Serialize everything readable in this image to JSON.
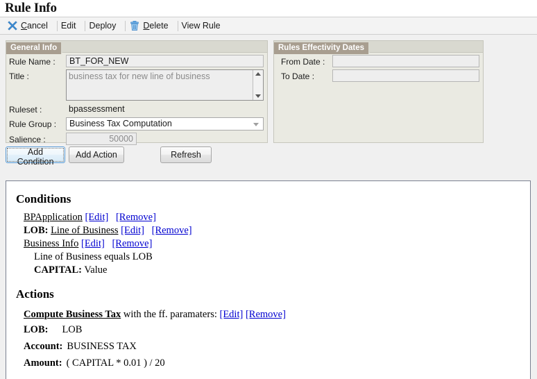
{
  "page": {
    "title": "Rule Info"
  },
  "toolbar": {
    "items": [
      {
        "label": "Cancel",
        "accel": "C",
        "icon": "close-x-icon"
      },
      {
        "label": "Edit",
        "accel": "",
        "icon": ""
      },
      {
        "label": "Deploy",
        "accel": "",
        "icon": ""
      },
      {
        "label": "Delete",
        "accel": "D",
        "icon": "trash-icon"
      },
      {
        "label": "View Rule",
        "accel": "",
        "icon": ""
      }
    ]
  },
  "general_info": {
    "tab_label": "General Info",
    "rule_name_label": "Rule Name :",
    "rule_name_value": "BT_FOR_NEW",
    "title_label": "Title :",
    "title_value": "business tax for new line of business",
    "ruleset_label": "Ruleset :",
    "ruleset_value": "bpassessment",
    "rule_group_label": "Rule Group :",
    "rule_group_value": "Business Tax Computation",
    "salience_label": "Salience :",
    "salience_value": "50000"
  },
  "effectivity_dates": {
    "tab_label": "Rules Effectivity Dates",
    "from_date_label": "From Date :",
    "from_date_value": "",
    "to_date_label": "To Date :",
    "to_date_value": ""
  },
  "buttons": {
    "add_condition": "Add Condition",
    "add_action": "Add Action",
    "refresh": "Refresh"
  },
  "conditions": {
    "heading": "Conditions",
    "rows": [
      {
        "prefix": "",
        "name": "BPApplication",
        "edit": "[Edit]",
        "remove": "[Remove]"
      },
      {
        "prefix": "LOB:",
        "name": "Line of Business",
        "edit": "[Edit]",
        "remove": "[Remove]"
      },
      {
        "prefix": "",
        "name": "Business Info",
        "edit": "[Edit]",
        "remove": "[Remove]"
      }
    ],
    "detail_lines": [
      {
        "bold": "",
        "text": "Line of Business equals LOB"
      },
      {
        "bold": "CAPITAL:",
        "text": "Value"
      }
    ]
  },
  "actions": {
    "heading": "Actions",
    "action_name": "Compute Business Tax",
    "action_suffix": "with the ff. paramaters:",
    "edit": "[Edit]",
    "remove": "[Remove]",
    "parameters": [
      {
        "key": "LOB:",
        "value": "LOB"
      },
      {
        "key": "Account:",
        "value": "BUSINESS TAX"
      },
      {
        "key": "Amount:",
        "value": "( CAPITAL * 0.01 ) / 20"
      }
    ]
  },
  "colors": {
    "link": "#0000d0",
    "panel_tab": "#a89e90",
    "panel_bg": "#eaeae2",
    "icon_blue": "#4a90d9",
    "focus_border": "#5b9bd5"
  }
}
